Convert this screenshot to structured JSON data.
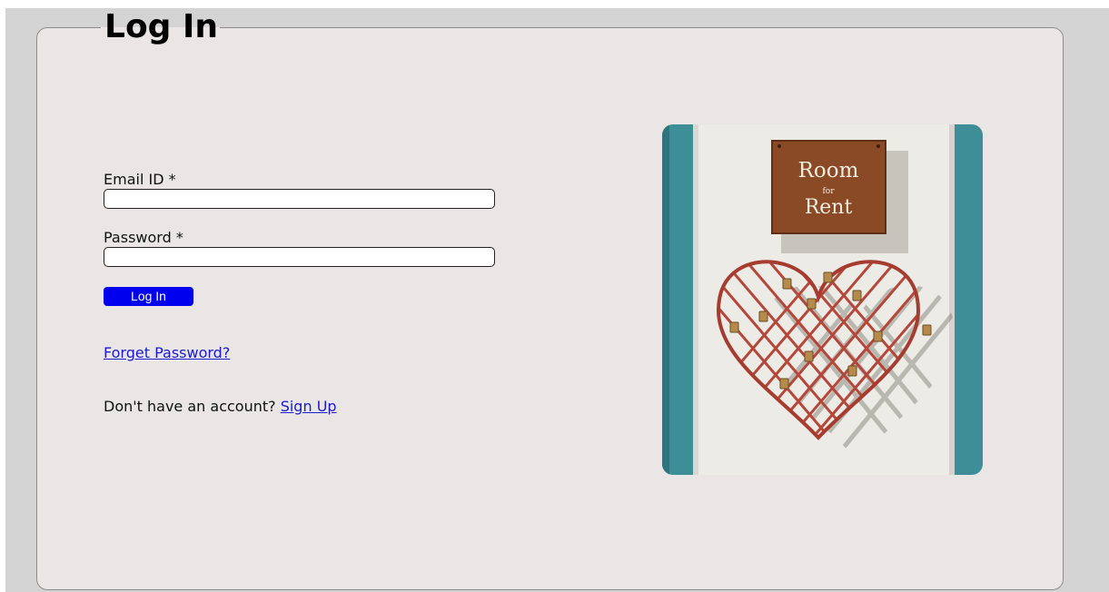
{
  "title": "Log In",
  "form": {
    "email_label": "Email ID *",
    "email_value": "",
    "password_label": "Password *",
    "password_value": "",
    "submit_label": "Log In",
    "forgot_label": "Forget Password?",
    "signup_prompt": "Don't have an account? ",
    "signup_label": "Sign Up"
  },
  "photo": {
    "sign_line1": "Room",
    "sign_line2": "for",
    "sign_line3": "Rent"
  },
  "colors": {
    "panel_bg": "#e9e6e5",
    "page_bg": "#d4d4d4",
    "button_bg": "#0000ee",
    "link": "#1a1ad0",
    "door_teal": "#3d8e97",
    "heart_red": "#b5473a"
  }
}
